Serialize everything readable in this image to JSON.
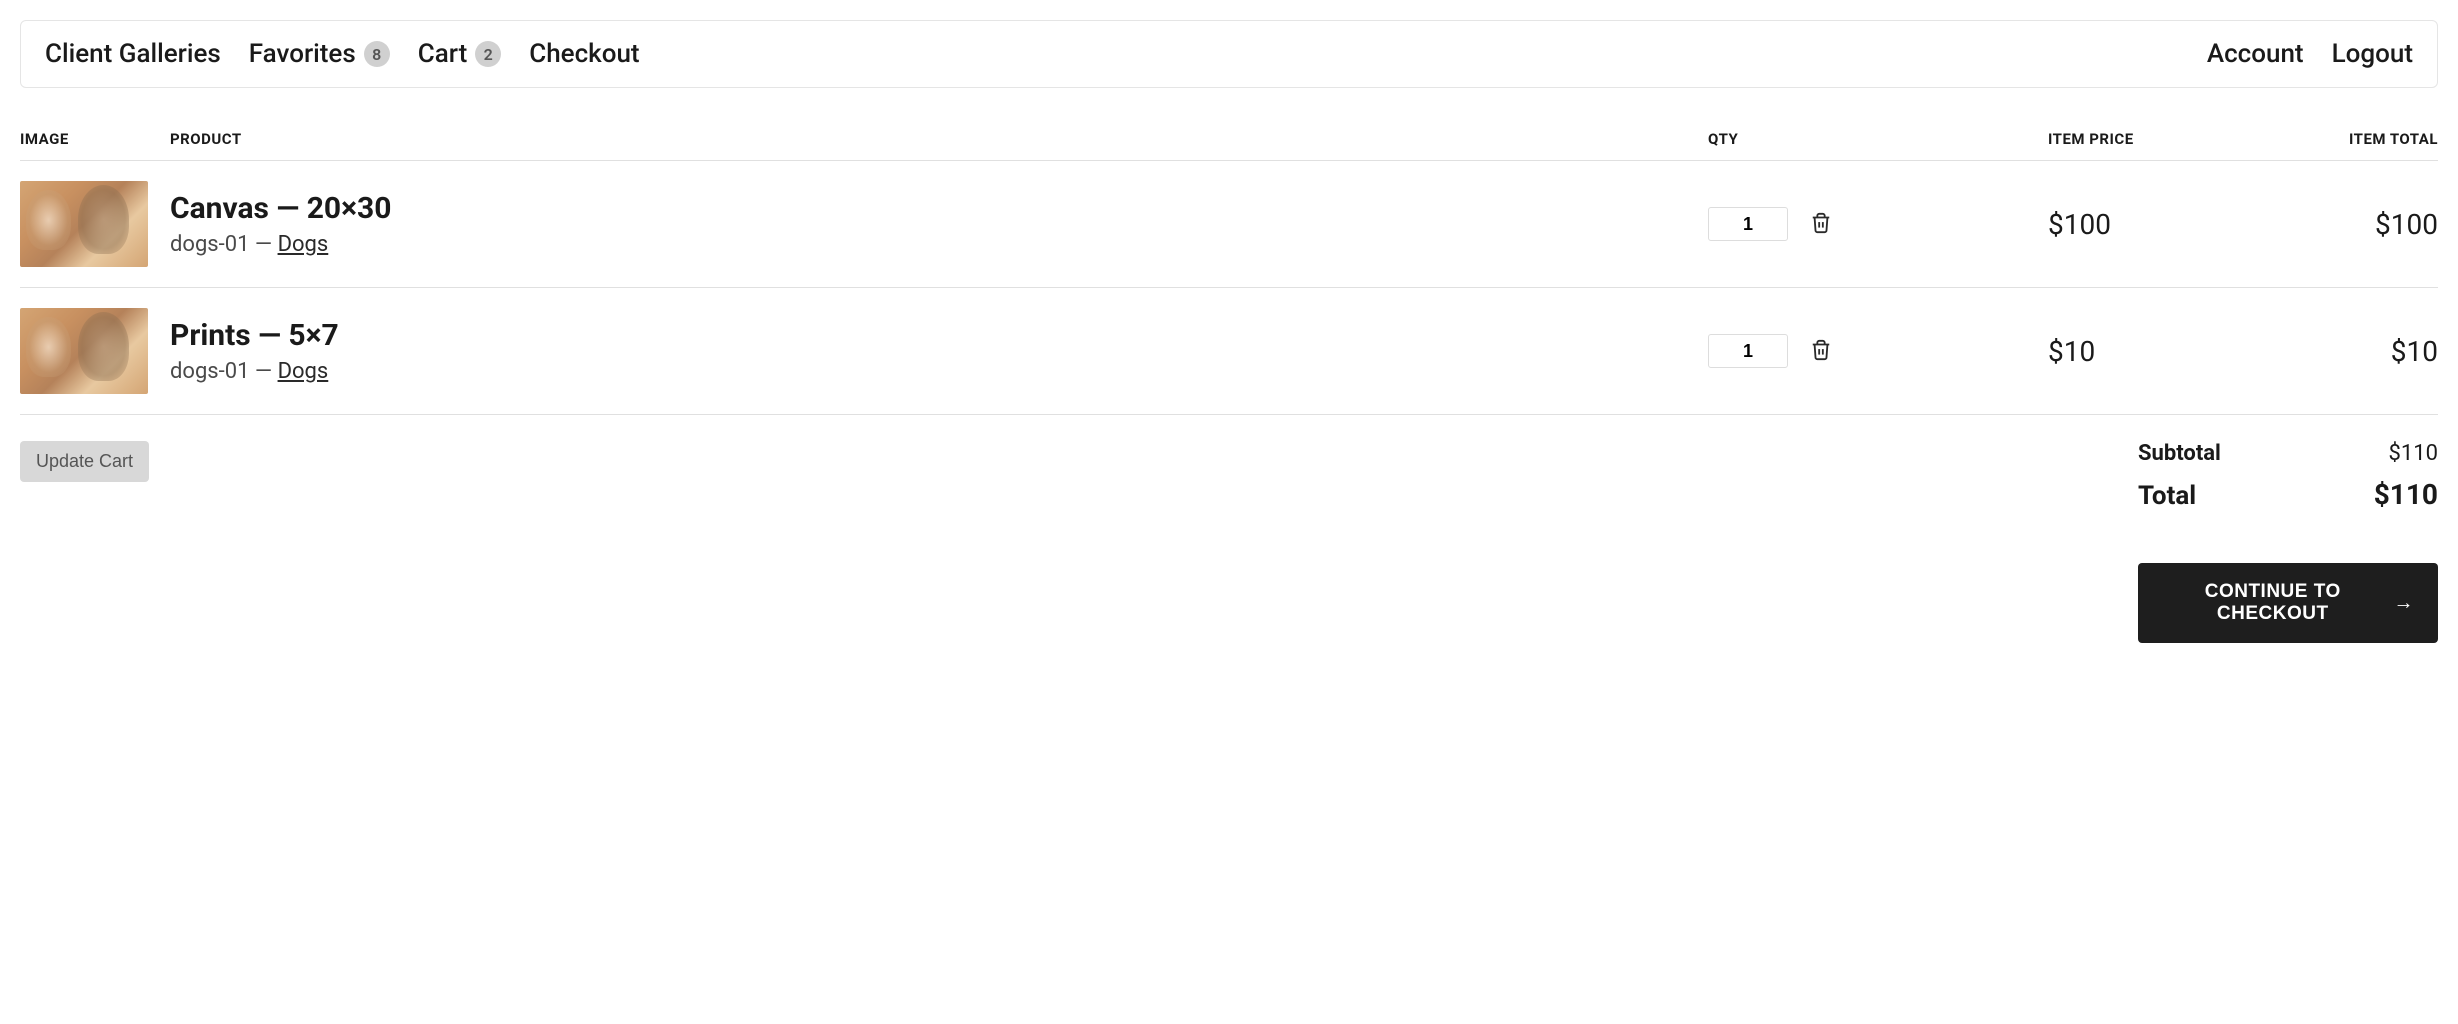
{
  "nav": {
    "left": [
      {
        "label": "Client Galleries",
        "badge": null
      },
      {
        "label": "Favorites",
        "badge": "8"
      },
      {
        "label": "Cart",
        "badge": "2"
      },
      {
        "label": "Checkout",
        "badge": null
      }
    ],
    "right": [
      {
        "label": "Account"
      },
      {
        "label": "Logout"
      }
    ]
  },
  "columns": {
    "image": "IMAGE",
    "product": "PRODUCT",
    "qty": "QTY",
    "price": "ITEM PRICE",
    "total": "ITEM TOTAL"
  },
  "items": [
    {
      "title": "Canvas — 20×30",
      "meta_prefix": "dogs-01 — ",
      "gallery": "Dogs",
      "qty": "1",
      "price": "$100",
      "total": "$100"
    },
    {
      "title": "Prints — 5×7",
      "meta_prefix": "dogs-01 — ",
      "gallery": "Dogs",
      "qty": "1",
      "price": "$10",
      "total": "$10"
    }
  ],
  "footer": {
    "update_label": "Update Cart",
    "subtotal_label": "Subtotal",
    "subtotal_value": "$110",
    "total_label": "Total",
    "total_value": "$110",
    "checkout_label": "CONTINUE TO CHECKOUT"
  }
}
